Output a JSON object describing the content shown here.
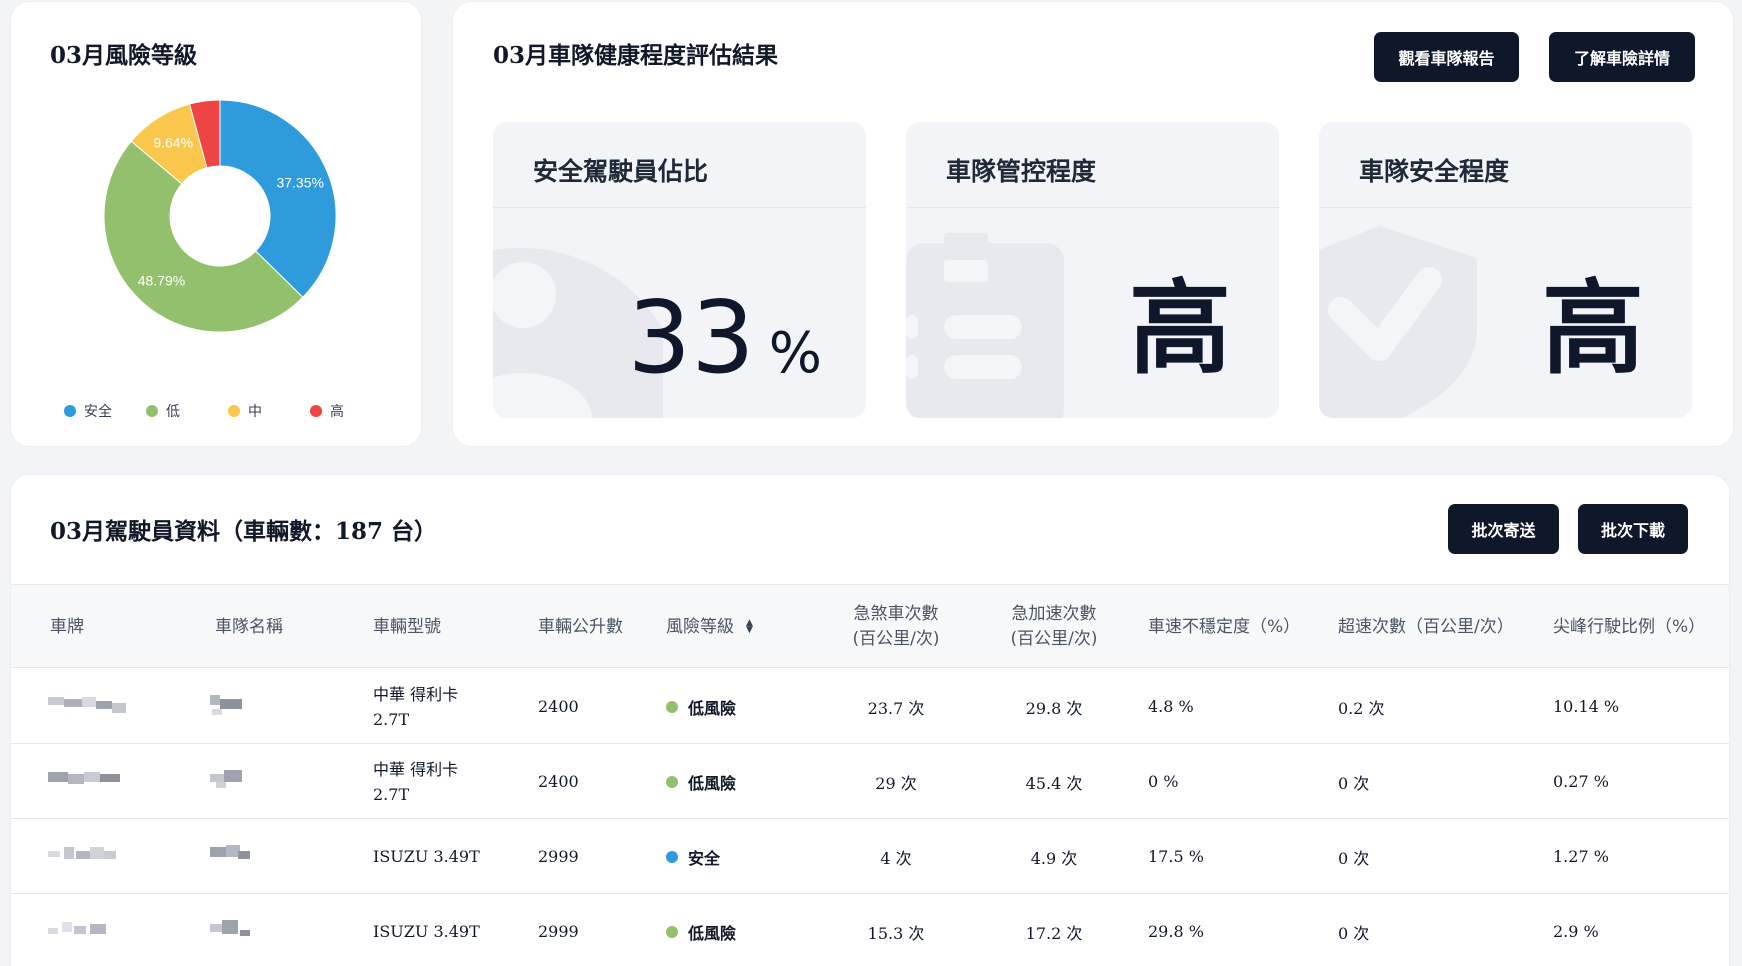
{
  "risk_card": {
    "title": "03月風險等級",
    "chart_data": {
      "type": "pie",
      "donut": true,
      "title": "",
      "categories": [
        "安全",
        "低",
        "中",
        "高"
      ],
      "values": [
        37.35,
        48.79,
        9.64,
        4.22
      ],
      "labels": [
        "37.35%",
        "48.79%",
        "9.64%",
        ""
      ],
      "colors": [
        "#2e9bdc",
        "#93c06d",
        "#f8c74c",
        "#ef4444"
      ],
      "legend_position": "bottom"
    }
  },
  "health_card": {
    "title": "03月車隊健康程度評估結果",
    "buttons": {
      "report": "觀看車隊報告",
      "insurance": "了解車險詳情"
    },
    "tiles": [
      {
        "title": "安全駕駛員佔比",
        "value": "33",
        "unit": "%",
        "icon": "user-icon"
      },
      {
        "title": "車隊管控程度",
        "value": "高",
        "icon": "clipboard-icon"
      },
      {
        "title": "車隊安全程度",
        "value": "高",
        "icon": "shield-check-icon"
      }
    ]
  },
  "driver_card": {
    "title": "03月駕駛員資料（車輛數：187 台）",
    "buttons": {
      "batch_send": "批次寄送",
      "batch_download": "批次下載"
    },
    "columns": {
      "plate": "車牌",
      "fleet": "車隊名稱",
      "model": "車輛型號",
      "displacement": "車輛公升數",
      "risk": "風險等級",
      "brake_1": "急煞車次數",
      "brake_2": "(百公里/次)",
      "accel_1": "急加速次數",
      "accel_2": "(百公里/次)",
      "speed_instability": "車速不穩定度（%）",
      "overspeed": "超速次數（百公里/次）",
      "peak_ratio": "尖峰行駛比例（%）"
    },
    "rows": [
      {
        "model_1": "中華 得利卡",
        "model_2": "2.7T",
        "displacement": "2400",
        "risk": "低風險",
        "risk_color": "#93c06d",
        "brake": "23.7 次",
        "accel": "29.8 次",
        "speed": "4.8 %",
        "overspeed": "0.2 次",
        "peak": "10.14 %"
      },
      {
        "model_1": "中華 得利卡",
        "model_2": "2.7T",
        "displacement": "2400",
        "risk": "低風險",
        "risk_color": "#93c06d",
        "brake": "29 次",
        "accel": "45.4 次",
        "speed": "0 %",
        "overspeed": "0 次",
        "peak": "0.27 %"
      },
      {
        "model_1": "ISUZU 3.49T",
        "model_2": "",
        "displacement": "2999",
        "risk": "安全",
        "risk_color": "#2e9bdc",
        "brake": "4 次",
        "accel": "4.9 次",
        "speed": "17.5 %",
        "overspeed": "0 次",
        "peak": "1.27 %"
      },
      {
        "model_1": "ISUZU 3.49T",
        "model_2": "",
        "displacement": "2999",
        "risk": "低風險",
        "risk_color": "#93c06d",
        "brake": "15.3 次",
        "accel": "17.2 次",
        "speed": "29.8 %",
        "overspeed": "0 次",
        "peak": "2.9 %"
      }
    ]
  }
}
